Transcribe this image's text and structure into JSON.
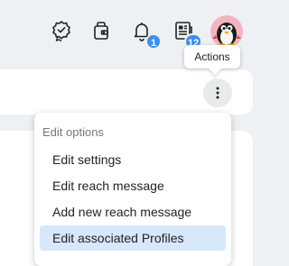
{
  "topbar": {
    "icons": [
      {
        "name": "badge-check-icon"
      },
      {
        "name": "wallet-icon"
      },
      {
        "name": "notification-bell-icon",
        "badge": "1"
      },
      {
        "name": "news-icon",
        "badge": "12"
      }
    ],
    "avatar": {
      "name": "penguin-avatar"
    }
  },
  "tooltip": {
    "text": "Actions"
  },
  "menu": {
    "header": "Edit options",
    "items": [
      {
        "label": "Edit settings"
      },
      {
        "label": "Edit reach message"
      },
      {
        "label": "Add new reach message"
      },
      {
        "label": "Edit associated Profiles",
        "selected": true
      }
    ]
  },
  "colors": {
    "accent": "#3b8ff0",
    "selected_bg": "#d7e8fb",
    "avatar_bg": "#f3b4be",
    "background": "#eef0f3"
  }
}
